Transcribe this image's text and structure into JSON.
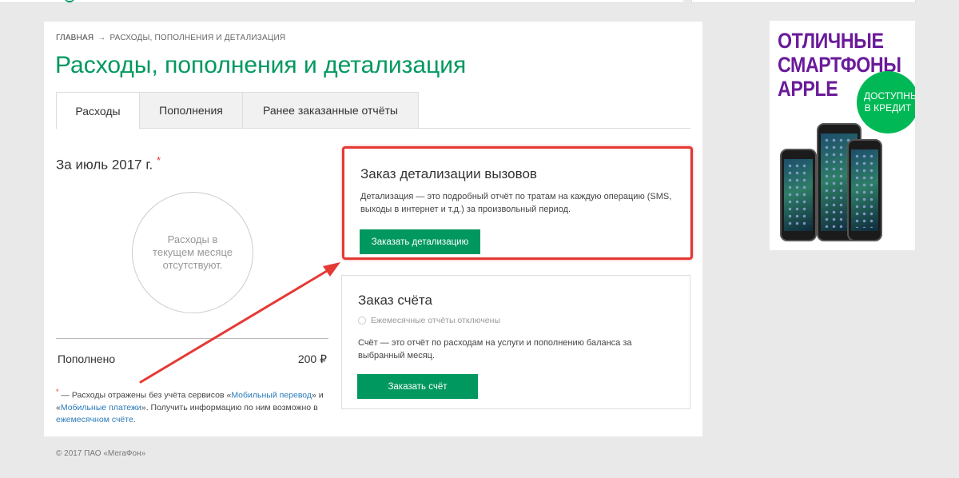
{
  "breadcrumb": {
    "home": "ГЛАВНАЯ",
    "separator": "→",
    "current": "РАСХОДЫ, ПОПОЛНЕНИЯ И ДЕТАЛИЗАЦИЯ"
  },
  "page": {
    "title": "Расходы, пополнения и детализация"
  },
  "tabs": [
    {
      "label": "Расходы",
      "active": true
    },
    {
      "label": "Пополнения",
      "active": false
    },
    {
      "label": "Ранее заказанные отчёты",
      "active": false
    }
  ],
  "expenses": {
    "period": "За июль 2017 г.",
    "asterisk": "*",
    "empty_message": "Расходы в текущем месяце отсутствуют.",
    "topup_label": "Пополнено",
    "topup_value": "200 ₽"
  },
  "footnote": {
    "asterisk": "*",
    "text1": " — Расходы отражены без учёта сервисов «",
    "link1": "Мобильный перевод",
    "text2": "» и «",
    "link2": "Мобильные платежи",
    "text3": "». Получить информацию по ним возможно в ",
    "link3": "ежемесячном счёте",
    "text4": "."
  },
  "detail_order": {
    "title": "Заказ детализации вызовов",
    "description": "Детализация — это подробный отчёт по тратам на каждую операцию (SMS, выходы в интернет и т.д.) за произвольный период.",
    "button": "Заказать детализацию"
  },
  "bill_order": {
    "title": "Заказ счёта",
    "radio_label": "Ежемесячные отчёты отключены",
    "description": "Счёт — это отчёт по расходам на услуги и пополнению баланса за выбранный месяц.",
    "button": "Заказать счёт"
  },
  "footer": {
    "copyright": "© 2017 ПАО «МегаФон»"
  },
  "ad": {
    "line1": "ОТЛИЧНЫЕ",
    "line2": "СМАРТФОНЫ",
    "line3": "APPLE",
    "badge": "ДОСТУПНЫ В КРЕДИТ"
  },
  "colors": {
    "brand_green": "#00985f",
    "annotation_red": "#e53935",
    "ad_purple": "#6a1b9a",
    "ad_badge_green": "#00b956",
    "link_blue": "#2a7ab8"
  }
}
